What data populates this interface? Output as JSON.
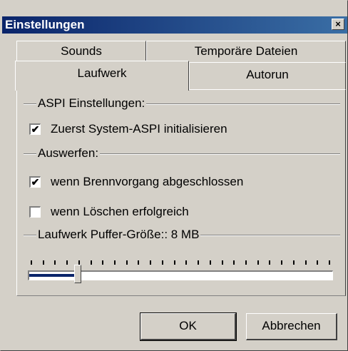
{
  "window": {
    "title": "Einstellungen",
    "close_symbol": "×"
  },
  "tabs": {
    "row_back": [
      {
        "label": "Sounds"
      },
      {
        "label": "Temporäre Dateien"
      }
    ],
    "row_front": [
      {
        "label": "Laufwerk"
      },
      {
        "label": "Autorun"
      }
    ],
    "active": "Laufwerk"
  },
  "aspi": {
    "group_label": "ASPI Einstellungen:",
    "init_label": "Zuerst System-ASPI initialisieren",
    "init_checked": true
  },
  "eject": {
    "group_label": "Auswerfen:",
    "after_burn_label": "wenn Brennvorgang abgeschlossen",
    "after_burn_checked": true,
    "after_erase_label": "wenn Löschen erfolgreich",
    "after_erase_checked": false
  },
  "buffer": {
    "group_label": "Laufwerk Puffer-Größe:: 8 MB",
    "slider_fraction": 0.16
  },
  "buttons": {
    "ok": "OK",
    "cancel": "Abbrechen"
  },
  "check_symbol": "✔",
  "colors": {
    "face": "#d4d0c8",
    "titlebar_start": "#0a246a",
    "titlebar_end": "#3a6ea5",
    "slider_fill": "#0a246a"
  }
}
